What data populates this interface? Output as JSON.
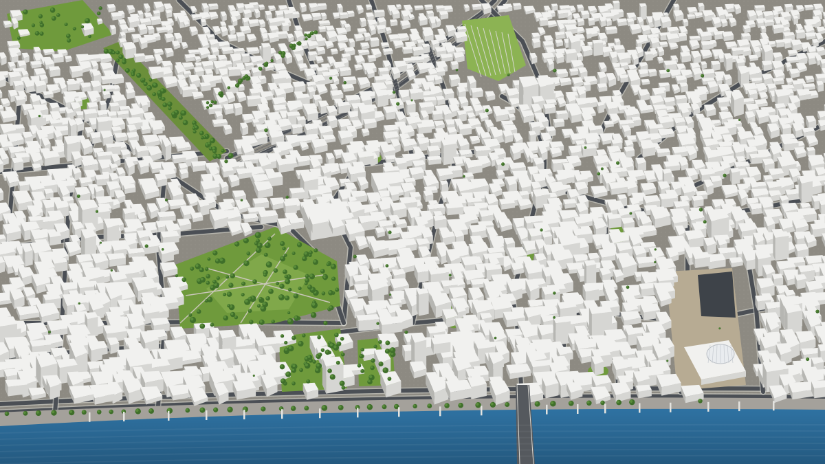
{
  "scene": {
    "kind": "3d-city-model",
    "view": "aerial-oblique",
    "style": "untextured-white-buildings"
  },
  "colors": {
    "ground": "#8d8a82",
    "block_base": "#a9a59c",
    "road": "#4b4f55",
    "road_edge": "#d9d8d2",
    "building_light": "#f1f1ef",
    "building_mid": "#d6d6d3",
    "building_shadow": "#b6b6b2",
    "park": "#6f9a3c",
    "park_light": "#8cb353",
    "tree": "#3f6f2a",
    "river": "#2f6f9e",
    "river_deep": "#265e88",
    "plaza": "#b7ab93",
    "dark_plaza": "#3e4349",
    "promenade": "#a4a19b"
  },
  "features": [
    {
      "id": "river",
      "kind": "water",
      "label": ""
    },
    {
      "id": "central-park",
      "kind": "park",
      "label": ""
    },
    {
      "id": "riverside-park",
      "kind": "park",
      "label": ""
    },
    {
      "id": "formal-garden",
      "kind": "park",
      "label": ""
    },
    {
      "id": "tree-avenue",
      "kind": "trees",
      "label": ""
    },
    {
      "id": "rail-corridor",
      "kind": "rail",
      "label": ""
    },
    {
      "id": "main-bridge",
      "kind": "bridge",
      "label": ""
    },
    {
      "id": "domed-building",
      "kind": "landmark",
      "label": ""
    },
    {
      "id": "riverside-plaza",
      "kind": "plaza",
      "label": ""
    },
    {
      "id": "historic-quarter",
      "kind": "district",
      "label": ""
    }
  ]
}
